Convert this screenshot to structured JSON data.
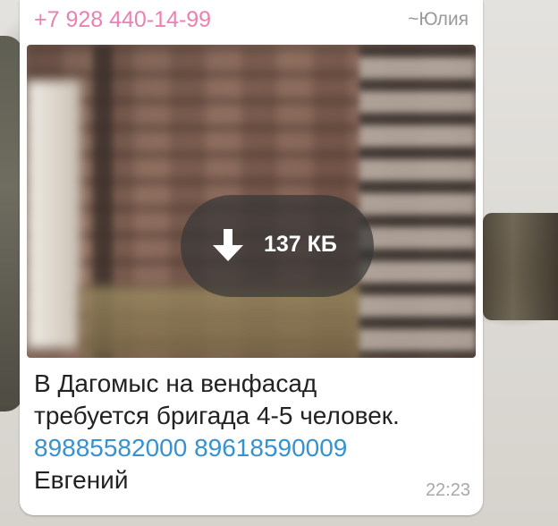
{
  "message": {
    "sender_phone": "+7 928 440-14-99",
    "sender_name": "~Юлия",
    "photo": {
      "download_size": "137 КБ",
      "icon": "download-arrow-icon"
    },
    "text_line1": "В Дагомыс на венфасад",
    "text_line2": "требуется бригада 4-5 человек.",
    "phone1": "89885582000",
    "phone2": "89618590009",
    "signature": "Евгений",
    "time": "22:23"
  },
  "colors": {
    "sender": "#e981b3",
    "link": "#3792cf",
    "bubble": "#ffffff",
    "text": "#222222"
  }
}
